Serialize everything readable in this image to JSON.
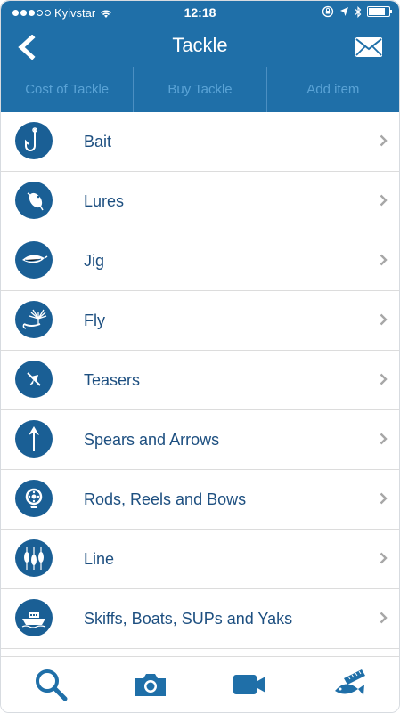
{
  "status": {
    "carrier": "Kyivstar",
    "time": "12:18"
  },
  "header": {
    "title": "Tackle"
  },
  "tabs": [
    {
      "label": "Cost of Tackle"
    },
    {
      "label": "Buy Tackle"
    },
    {
      "label": "Add item"
    }
  ],
  "items": [
    {
      "label": "Bait",
      "icon": "fish-hook-icon"
    },
    {
      "label": "Lures",
      "icon": "lure-icon"
    },
    {
      "label": "Jig",
      "icon": "jig-icon"
    },
    {
      "label": "Fly",
      "icon": "fly-icon"
    },
    {
      "label": "Teasers",
      "icon": "teaser-icon"
    },
    {
      "label": "Spears and Arrows",
      "icon": "arrow-icon"
    },
    {
      "label": "Rods, Reels and Bows",
      "icon": "reel-icon"
    },
    {
      "label": "Line",
      "icon": "bobbers-icon"
    },
    {
      "label": "Skiffs, Boats, SUPs and Yaks",
      "icon": "boat-icon"
    }
  ],
  "tabbar": [
    {
      "icon": "search-icon"
    },
    {
      "icon": "camera-icon"
    },
    {
      "icon": "video-camera-icon"
    },
    {
      "icon": "fish-ruler-icon"
    }
  ],
  "colors": {
    "brand": "#1f6fa8",
    "icon_circle": "#1a5f95",
    "label": "#1d4f80",
    "tab_text": "#5aa3d6"
  }
}
